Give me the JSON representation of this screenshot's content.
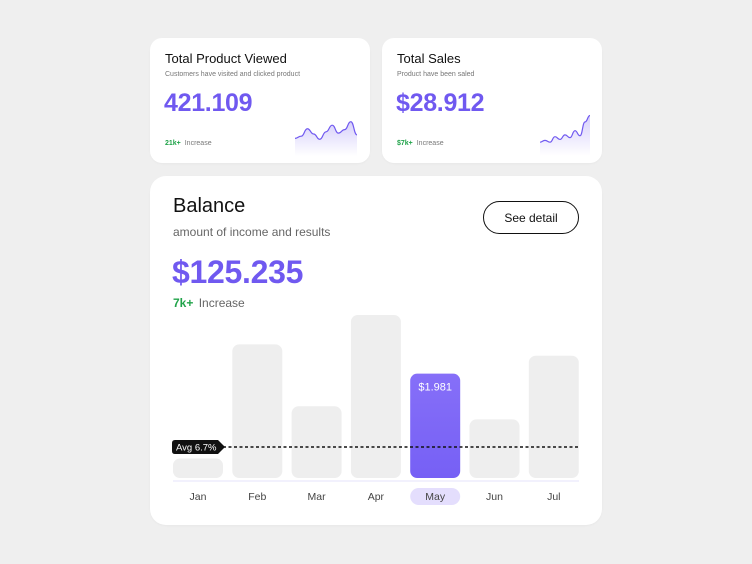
{
  "cards": [
    {
      "title": "Total Product Viewed",
      "subtitle": "Customers have visited and clicked product",
      "value": "421.109",
      "increase_num": "21k+",
      "increase_label": "Increase",
      "sparkline": [
        0.4,
        0.45,
        0.62,
        0.5,
        0.38,
        0.55,
        0.7,
        0.52,
        0.6,
        0.78,
        0.48
      ]
    },
    {
      "title": "Total Sales",
      "subtitle": "Product have been saled",
      "value": "$28.912",
      "increase_num": "$7k+",
      "increase_label": "Increase",
      "sparkline": [
        0.3,
        0.34,
        0.3,
        0.42,
        0.36,
        0.46,
        0.4,
        0.55,
        0.44,
        0.74,
        0.88
      ]
    }
  ],
  "balance": {
    "title": "Balance",
    "subtitle": "amount of income and results",
    "value": "$125.235",
    "increase_num": "7k+",
    "increase_label": "Increase",
    "detail_button": "See detail"
  },
  "chart_data": {
    "type": "bar",
    "categories": [
      "Jan",
      "Feb",
      "Mar",
      "Apr",
      "May",
      "Jun",
      "Jul"
    ],
    "values": [
      0.12,
      0.82,
      0.44,
      1.0,
      0.64,
      0.36,
      0.75
    ],
    "highlighted": "May",
    "highlight_label": "$1.981",
    "average_label": "Avg 6.7%",
    "average_level": 0.19,
    "ylim": [
      0,
      1
    ],
    "colors": {
      "bar": "#eeeeee",
      "highlight": "#7660f5",
      "highlight_light": "#866ff8",
      "axis": "#e6e3fb",
      "month_pill": "#e4defd"
    }
  },
  "colors": {
    "accent": "#7059f0",
    "positive": "#21a34a"
  }
}
